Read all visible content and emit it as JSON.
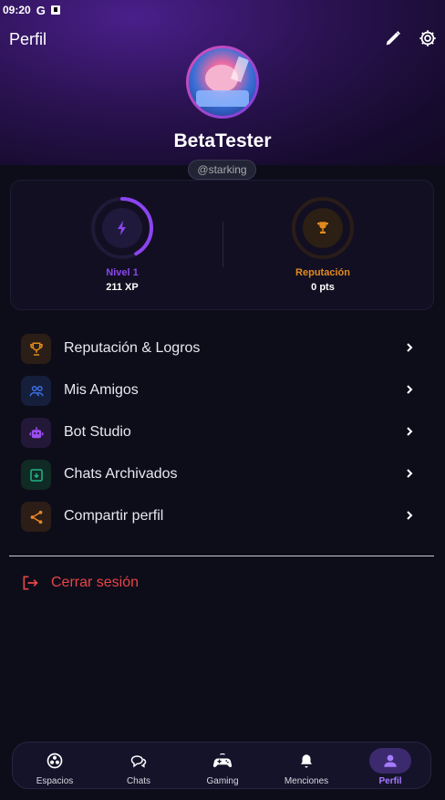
{
  "status_bar": {
    "time": "09:20",
    "google_letter": "G"
  },
  "header": {
    "title": "Perfil"
  },
  "profile": {
    "display_name": "BetaTester",
    "handle": "@starking"
  },
  "stats": {
    "level": {
      "label": "Nivel 1",
      "value": "211 XP",
      "progress": 0.42,
      "color": "#8b45f0"
    },
    "reputation": {
      "label": "Reputación",
      "value": "0 pts",
      "progress": 0,
      "color": "#e08a1e"
    }
  },
  "menu": [
    {
      "label": "Reputación & Logros",
      "icon": "trophy-icon",
      "color": "#e08a1e"
    },
    {
      "label": "Mis Amigos",
      "icon": "friends-icon",
      "color": "#3b6fe0"
    },
    {
      "label": "Bot Studio",
      "icon": "robot-icon",
      "color": "#9b4df0"
    },
    {
      "label": "Chats Archivados",
      "icon": "archive-icon",
      "color": "#1fb58a"
    },
    {
      "label": "Compartir perfil",
      "icon": "share-icon",
      "color": "#e8862a"
    }
  ],
  "logout": {
    "label": "Cerrar sesión",
    "color": "#e84545"
  },
  "bottom_nav": [
    {
      "label": "Espacios",
      "icon": "spaces-icon"
    },
    {
      "label": "Chats",
      "icon": "chats-icon"
    },
    {
      "label": "Gaming",
      "icon": "gamepad-icon"
    },
    {
      "label": "Menciones",
      "icon": "bell-icon"
    },
    {
      "label": "Perfil",
      "icon": "person-icon",
      "active": true
    }
  ],
  "colors": {
    "accent": "#8b45f0",
    "background": "#0d0d1a",
    "active_nav": "#a77bff"
  }
}
